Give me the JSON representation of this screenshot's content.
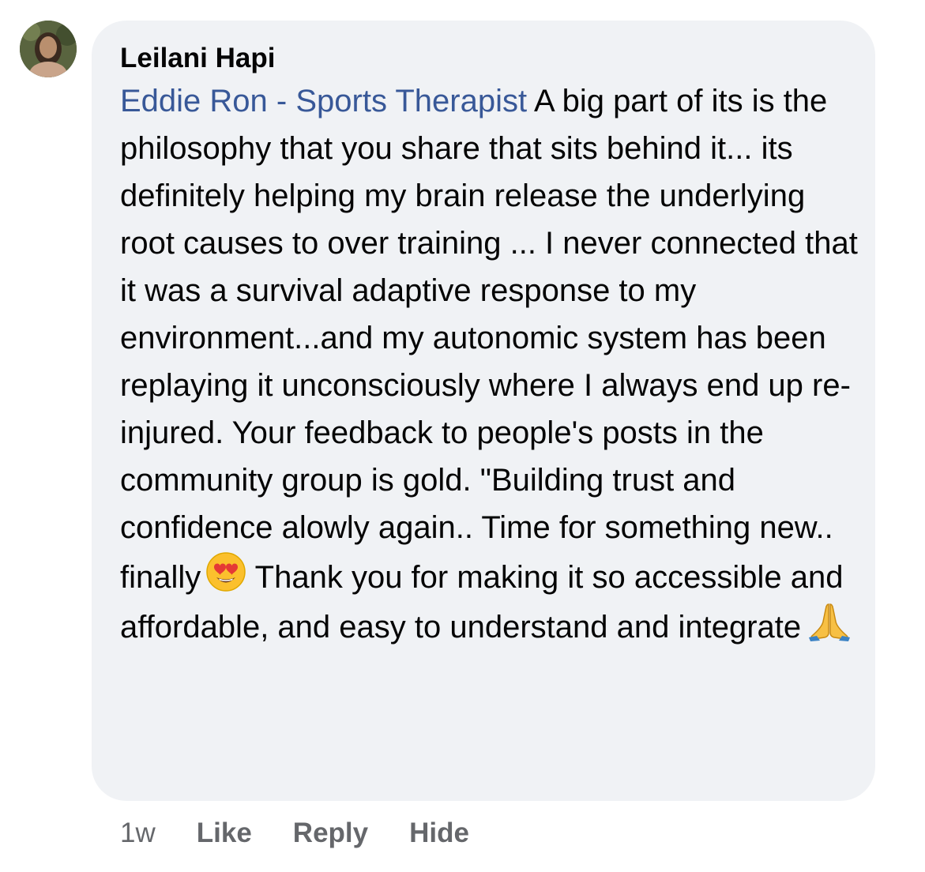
{
  "comment": {
    "author": "Leilani Hapi",
    "mention": "Eddie Ron - Sports Therapist",
    "text_before_emoji_1": " A big part of its is the philosophy that you share that sits behind it... its definitely helping my brain release the underlying root causes to over training ... I never connected that it was a survival adaptive response to my environment...and my autonomic system has been replaying it unconsciously where I always end up re-injured. Your feedback to people's posts in the community group is gold. \"Building trust and confidence alowly again.. Time for something new..  finally",
    "emoji_1": "heart-eyes-emoji",
    "text_before_emoji_2": " Thank you for making it so accessible and affordable, and easy to understand and integrate",
    "emoji_2": "folded-hands-emoji"
  },
  "actions": {
    "time": "1w",
    "like": "Like",
    "reply": "Reply",
    "hide": "Hide"
  },
  "colors": {
    "bubble": "#f0f2f5",
    "mention": "#385898",
    "meta": "#65676b"
  }
}
